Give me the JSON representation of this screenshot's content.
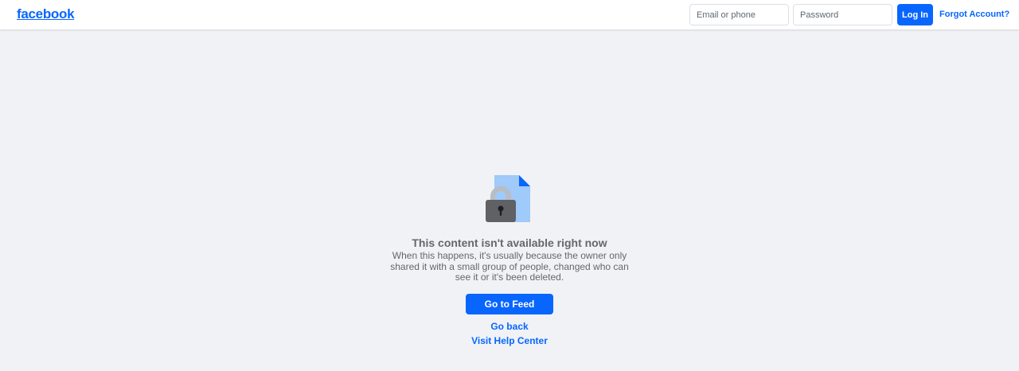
{
  "header": {
    "logo_text": "facebook",
    "email_placeholder": "Email or phone",
    "password_placeholder": "Password",
    "login_label": "Log In",
    "forgot_label": "Forgot Account?"
  },
  "main": {
    "illustration_icon": "locked-document-icon",
    "title": "This content isn't available right now",
    "description": "When this happens, it's usually because the owner only shared it with a small group of people, changed who can see it or it's been deleted.",
    "go_to_feed_label": "Go to Feed",
    "go_back_label": "Go back",
    "help_center_label": "Visit Help Center"
  },
  "colors": {
    "brand_blue": "#0866ff",
    "page_background": "#f0f2f5",
    "muted_text": "#65676b",
    "document_light_blue": "#9fcaf9",
    "lock_gray": "#5f6164"
  }
}
